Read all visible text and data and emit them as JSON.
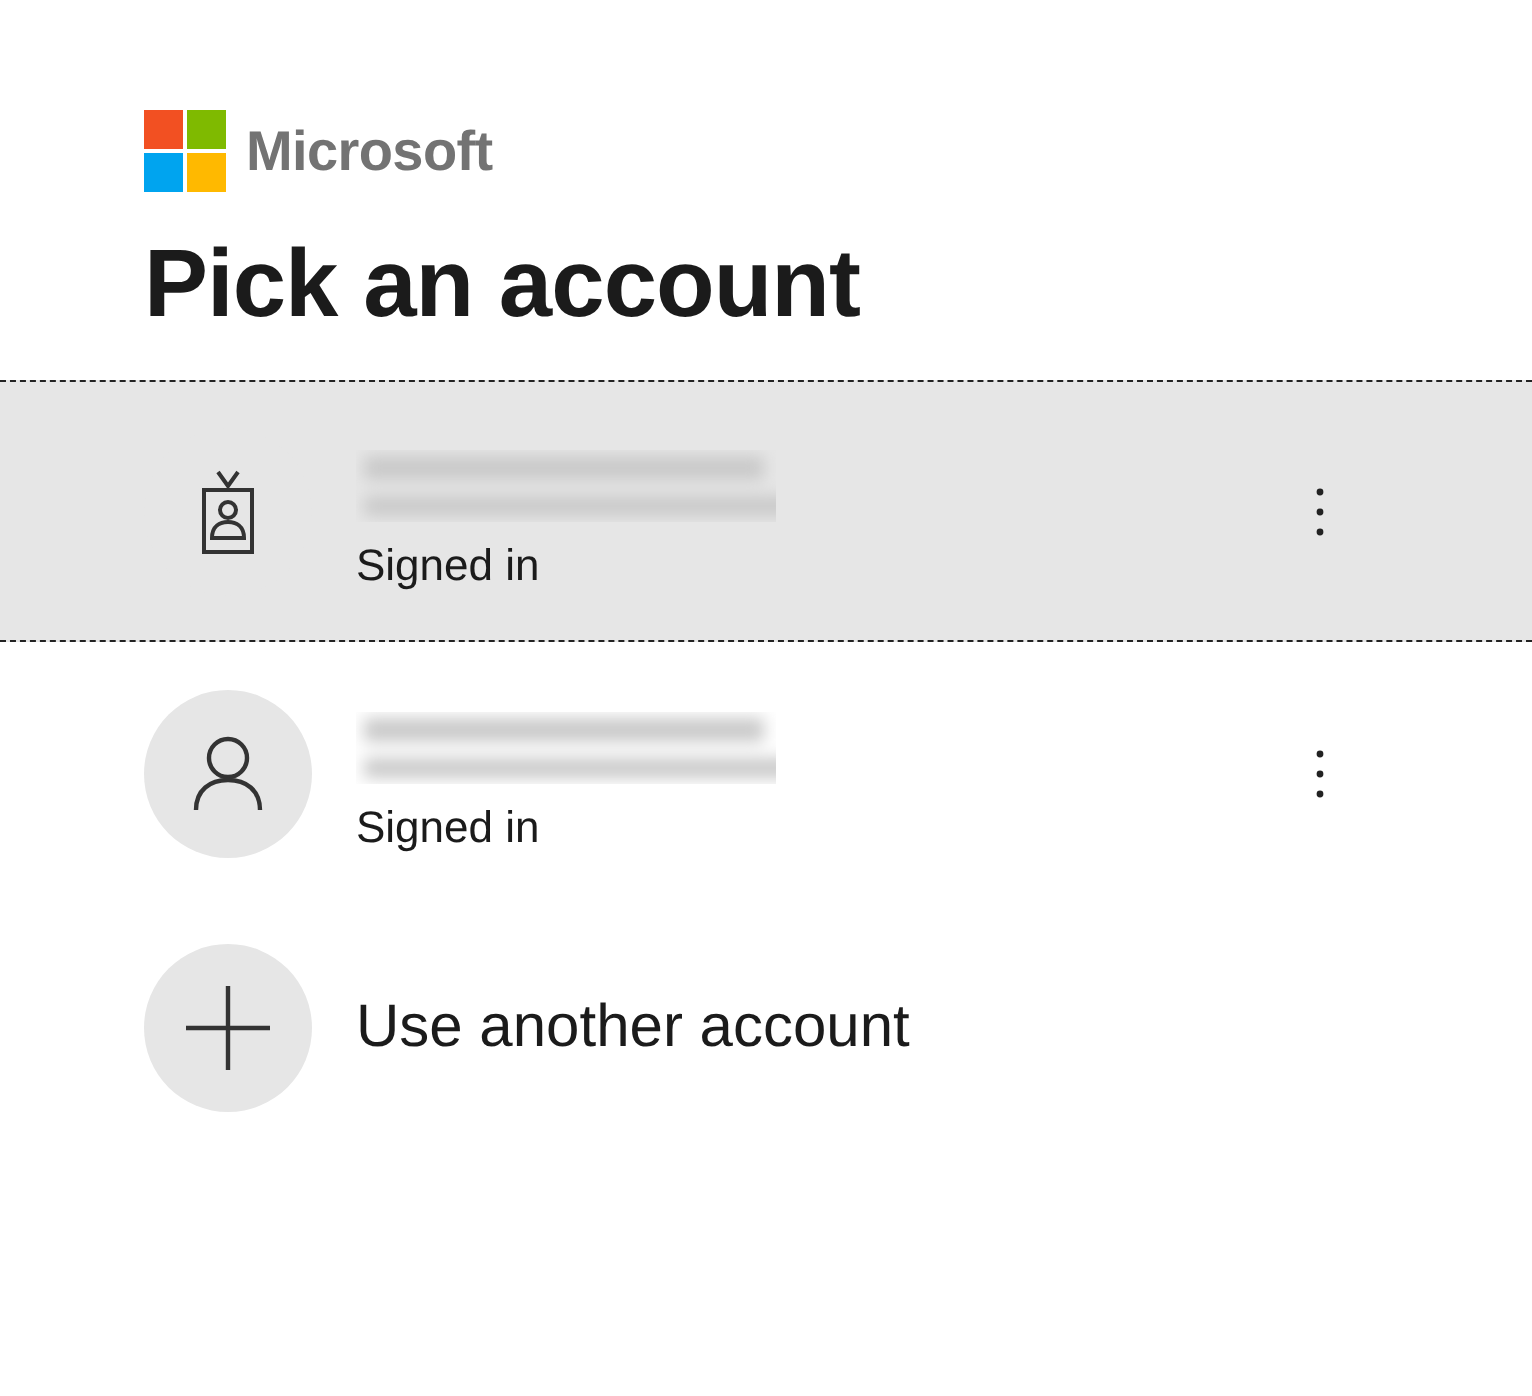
{
  "logo": {
    "wordmark": "Microsoft"
  },
  "heading": "Pick an account",
  "accounts": [
    {
      "kind": "work",
      "status": "Signed in",
      "selected": true
    },
    {
      "kind": "personal",
      "status": "Signed in",
      "selected": false
    }
  ],
  "add_account": {
    "label": "Use another account"
  }
}
